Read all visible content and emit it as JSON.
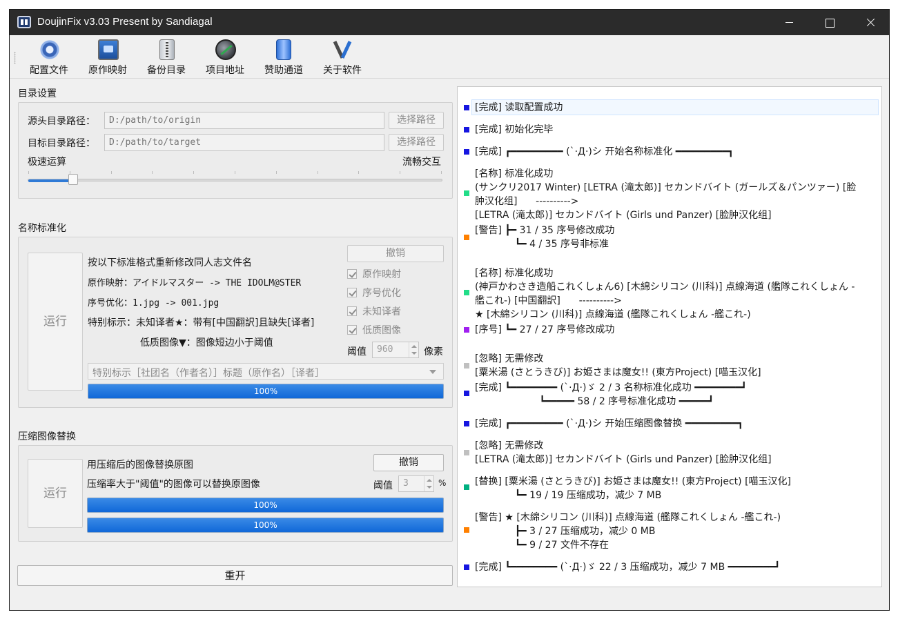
{
  "window": {
    "title": "DoujinFix v3.03 Present by Sandiagal"
  },
  "toolbar": [
    {
      "label": "配置文件",
      "icon": "gear-icon"
    },
    {
      "label": "原作映射",
      "icon": "mapping-icon"
    },
    {
      "label": "备份目录",
      "icon": "backup-icon"
    },
    {
      "label": "项目地址",
      "icon": "project-icon"
    },
    {
      "label": "赞助通道",
      "icon": "sponsor-icon"
    },
    {
      "label": "关于软件",
      "icon": "about-icon"
    }
  ],
  "dir_settings": {
    "title": "目录设置",
    "source_label": "源头目录路径：",
    "source_placeholder": "D:/path/to/origin",
    "target_label": "目标目录路径：",
    "target_placeholder": "D:/path/to/target",
    "choose_label": "选择路径",
    "speed_left": "极速运算",
    "speed_right": "流畅交互",
    "slider_value": 0.11
  },
  "name_norm": {
    "title": "名称标准化",
    "run_label": "运行",
    "cancel_label": "撤销",
    "desc": [
      "按以下标准格式重新修改同人志文件名",
      "原作映射：アイドルマスター -> THE IDOLM@STER",
      "序号优化：1.jpg -> 001.jpg",
      "特别标示：未知译者★：带有[中国翻訳]且缺失[译者]",
      "低质图像▼：图像短边小于阈值"
    ],
    "options": [
      "原作映射",
      "序号优化",
      "未知译者",
      "低质图像"
    ],
    "threshold_label": "阈值",
    "threshold_value": "960",
    "threshold_unit": "像素",
    "format_select": "特别标示［社团名（作者名）］标题（原作名）［译者］",
    "progress": "100%"
  },
  "compress": {
    "title": "压缩图像替换",
    "run_label": "运行",
    "cancel_label": "撤销",
    "desc": [
      "用压缩后的图像替换原图",
      "压缩率大于\"阈值\"的图像可以替换原图像"
    ],
    "threshold_label": "阈值",
    "threshold_value": "3",
    "threshold_unit": "%",
    "progress1": "100%",
    "progress2": "100%"
  },
  "restart_label": "重开",
  "colors": {
    "blue": "#1616e0",
    "green": "#22dd88",
    "orange": "#ff8000",
    "purple": "#a020f0",
    "gray": "#c0c0c0",
    "teal": "#00b080"
  },
  "log": [
    {
      "color": "blue",
      "text": "[完成] 读取配置成功"
    },
    {
      "color": "blue",
      "text": "[完成] 初始化完毕"
    },
    {
      "color": "blue",
      "text": "[完成] ┏━━━━━━━━━ (`·Д·)シ 开始名称标准化 ━━━━━━━━━┓"
    },
    {
      "color": "green",
      "text": "[名称] 标准化成功\n(サンクリ2017 Winter) [LETRA (滝太郎)] セカンドバイト (ガールズ＆パンツァー) [脸\n肿汉化组]      ---------->\n[LETRA (滝太郎)] セカンドバイト (Girls und Panzer) [脸肿汉化组]"
    },
    {
      "color": "orange",
      "text": "[警告] ┣━ 31 / 35 序号修改成功\n             ┗━ 4 / 35 序号非标准"
    },
    {
      "color": "green",
      "text": "[名称] 标准化成功\n(神戸かわさき造船これくしょん6) [木綿シリコン (川科)] 点線海道 (艦隊これくしょん -\n艦これ-) [中国翻訳]      ---------->\n★ [木綿シリコン (川科)] 点線海道 (艦隊これくしょん -艦これ-)"
    },
    {
      "color": "purple",
      "text": "[序号] ┗━ 27 / 27 序号修改成功"
    },
    {
      "color": "gray",
      "text": "[忽略] 无需修改\n[粟米湯 (さとうきび)] お姫さまは魔女!! (東方Project) [喵玉汉化]"
    },
    {
      "color": "blue",
      "text": "[完成] ┗━━━━━━━━ (`·Д·)ゞ 2 / 3 名称标准化成功 ━━━━━━━━┛\n                     ┗━━━━━ 58 / 2 序号标准化成功 ━━━━━┛"
    },
    {
      "color": "blue",
      "text": "[完成] ┏━━━━━━━━━ (`·Д·)シ 开始压缩图像替换 ━━━━━━━━━┓"
    },
    {
      "color": "gray",
      "text": "[忽略] 无需修改\n[LETRA (滝太郎)] セカンドバイト (Girls und Panzer) [脸肿汉化组]"
    },
    {
      "color": "teal",
      "text": "[替换] [粟米湯 (さとうきび)] お姫さまは魔女!! (東方Project) [喵玉汉化]\n             ┗━ 19 / 19 压缩成功，减少 7 MB"
    },
    {
      "color": "orange",
      "text": "[警告] ★ [木綿シリコン (川科)] 点線海道 (艦隊これくしょん -艦これ-)\n             ┣━ 3 / 27 压缩成功，减少 0 MB\n             ┗━ 9 / 27 文件不存在"
    },
    {
      "color": "blue",
      "text": "[完成] ┗━━━━━━━━ (`·Д·)ゞ 22 / 3 压缩成功，减少 7 MB ━━━━━━━━┛"
    }
  ]
}
